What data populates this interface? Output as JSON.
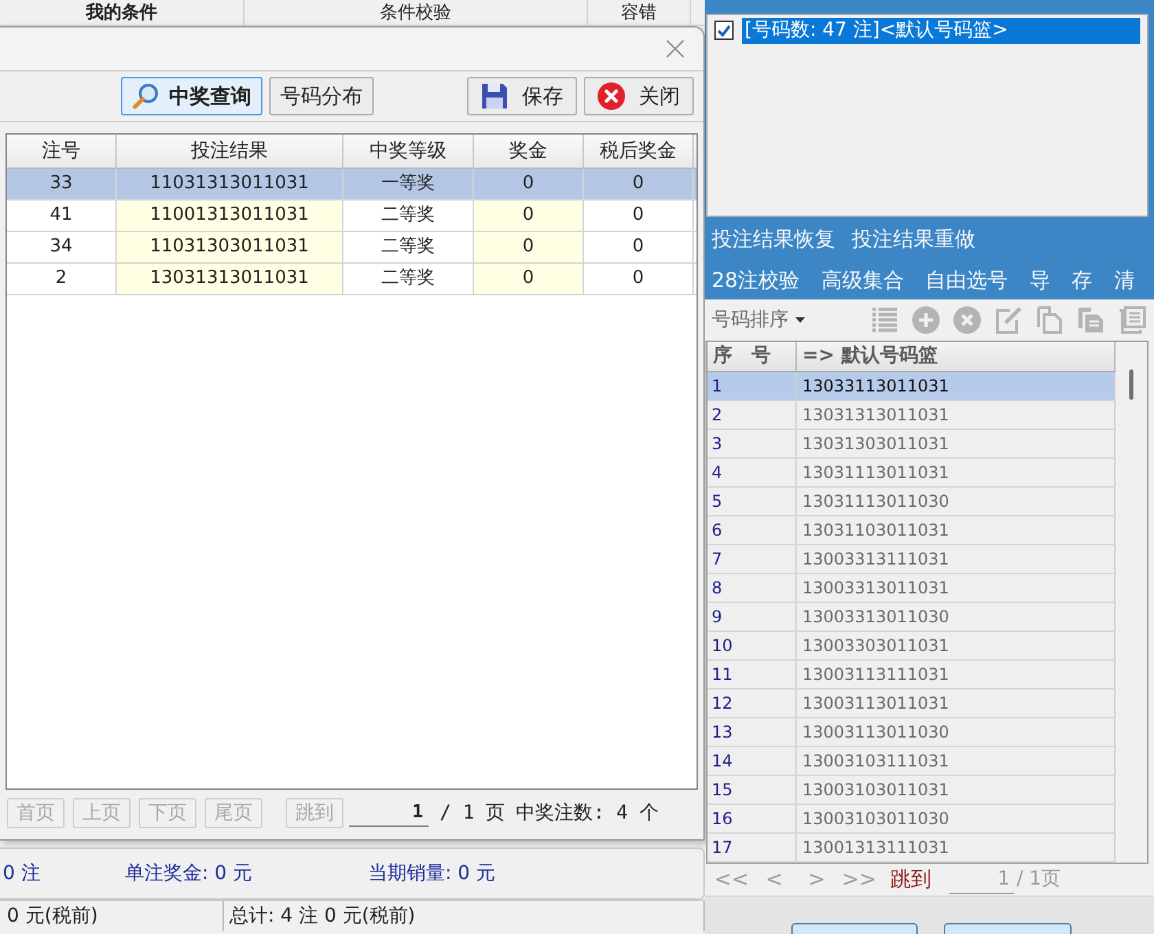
{
  "background_window": {
    "header": [
      "我的条件",
      "条件校验",
      "容错"
    ],
    "summary": [
      "0 注",
      "单注奖金: 0 元",
      "当期销量: 0 元"
    ],
    "status_bar": [
      "0 元(税前)",
      "总计: 4 注 0 元(税前)"
    ]
  },
  "dialog": {
    "toolbar": {
      "query_buttons": [
        {
          "kind": "search",
          "label": "中奖查询",
          "selected": true
        },
        {
          "kind": "plain",
          "label": "号码分布",
          "selected": false
        }
      ],
      "file_buttons": [
        {
          "kind": "save",
          "label": "保存"
        },
        {
          "kind": "close",
          "label": "关闭"
        }
      ]
    },
    "table": {
      "columns": [
        {
          "label": "注号",
          "highlight": false
        },
        {
          "label": "投注结果",
          "highlight": true
        },
        {
          "label": "中奖等级",
          "highlight": false
        },
        {
          "label": "奖金",
          "highlight": true
        },
        {
          "label": "税后奖金",
          "highlight": false
        }
      ],
      "rows": [
        {
          "cells": [
            "33",
            "11031313011031",
            "一等奖",
            "0",
            "0"
          ],
          "selected": true
        },
        {
          "cells": [
            "41",
            "11001313011031",
            "二等奖",
            "0",
            "0"
          ],
          "selected": false
        },
        {
          "cells": [
            "34",
            "11031303011031",
            "二等奖",
            "0",
            "0"
          ],
          "selected": false
        },
        {
          "cells": [
            "2",
            "13031313011031",
            "二等奖",
            "0",
            "0"
          ],
          "selected": false
        }
      ]
    },
    "pager": {
      "buttons": [
        {
          "label": "首页",
          "disabled": true
        },
        {
          "label": "上页",
          "disabled": true
        },
        {
          "label": "下页",
          "disabled": true
        },
        {
          "label": "尾页",
          "disabled": true
        }
      ],
      "jump": {
        "label": "跳到",
        "disabled": true
      },
      "page_input": "1",
      "page_total": "/ 1 页",
      "win_count": "中奖注数: 4 个"
    }
  },
  "right_panel": {
    "basket_list": [
      {
        "label": "[号码数: 47 注]<默认号码篮>",
        "checked": true,
        "selected": true
      }
    ],
    "actions": [
      [
        "投注结果恢复",
        "投注结果重做"
      ],
      [
        "28注校验",
        "高级集合",
        "自由选号",
        "导",
        "存",
        "清"
      ]
    ],
    "sort_menu": "号码排序",
    "tools": [
      {
        "kind": "list",
        "disabled": true
      },
      {
        "kind": "add",
        "disabled": true
      },
      {
        "kind": "remove",
        "disabled": true
      },
      {
        "kind": "edit",
        "disabled": true
      },
      {
        "kind": "copy",
        "disabled": true
      },
      {
        "kind": "paste",
        "disabled": true
      },
      {
        "kind": "document",
        "disabled": true
      }
    ],
    "grid": {
      "columns": [
        "序　号",
        "=> 默认号码篮"
      ],
      "rows": [
        {
          "index": "1",
          "value": "13033113011031",
          "selected": true
        },
        {
          "index": "2",
          "value": "13031313011031",
          "selected": false
        },
        {
          "index": "3",
          "value": "13031303011031",
          "selected": false
        },
        {
          "index": "4",
          "value": "13031113011031",
          "selected": false
        },
        {
          "index": "5",
          "value": "13031113011030",
          "selected": false
        },
        {
          "index": "6",
          "value": "13031103011031",
          "selected": false
        },
        {
          "index": "7",
          "value": "13003313111031",
          "selected": false
        },
        {
          "index": "8",
          "value": "13003313011031",
          "selected": false
        },
        {
          "index": "9",
          "value": "13003313011030",
          "selected": false
        },
        {
          "index": "10",
          "value": "13003303011031",
          "selected": false
        },
        {
          "index": "11",
          "value": "13003113111031",
          "selected": false
        },
        {
          "index": "12",
          "value": "13003113011031",
          "selected": false
        },
        {
          "index": "13",
          "value": "13003113011030",
          "selected": false
        },
        {
          "index": "14",
          "value": "13003103111031",
          "selected": false
        },
        {
          "index": "15",
          "value": "13003103011031",
          "selected": false
        },
        {
          "index": "16",
          "value": "13003103011030",
          "selected": false
        },
        {
          "index": "17",
          "value": "13001313111031",
          "selected": false
        }
      ]
    },
    "pager": {
      "buttons": [
        {
          "label": "<<",
          "disabled": true
        },
        {
          "label": "<",
          "disabled": true
        },
        {
          "label": ">",
          "disabled": true
        },
        {
          "label": ">>",
          "disabled": true
        }
      ],
      "jump": {
        "label": "跳到",
        "disabled": false
      },
      "page_input": "1",
      "page_total": "/ 1页"
    }
  }
}
